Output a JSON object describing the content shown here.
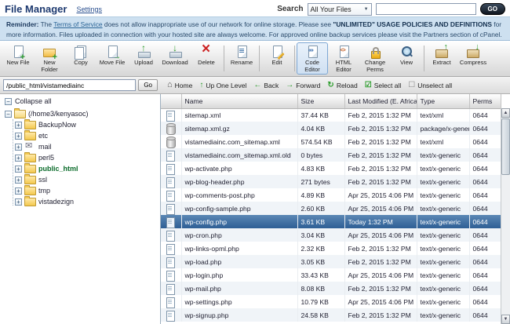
{
  "header": {
    "title": "File Manager",
    "settings": "Settings",
    "search_label": "Search",
    "search_scope": "All Your Files",
    "search_value": "",
    "go": "GO"
  },
  "notice": {
    "reminder": "Reminder:",
    "pre_link": " The ",
    "tos": "Terms of Service",
    "mid": " does not allow inappropriate use of our network for online storage. Please see ",
    "policy": "\"UNLIMITED\" USAGE POLICIES AND DEFINITIONS",
    "tail": " for more information. Files uploaded in connection with your hosted site are always welcome. For approved online backup services please visit the Partners section of cPanel."
  },
  "toolbar": {
    "items": [
      {
        "id": "new-file",
        "label": "New File",
        "icon": "newfile"
      },
      {
        "id": "new-folder",
        "label": "New Folder",
        "icon": "newfolder"
      },
      {
        "id": "copy",
        "label": "Copy",
        "icon": "copy"
      },
      {
        "id": "move-file",
        "label": "Move File",
        "icon": "move"
      },
      {
        "id": "upload",
        "label": "Upload",
        "icon": "upload"
      },
      {
        "id": "download",
        "label": "Download",
        "icon": "download"
      },
      {
        "id": "delete",
        "label": "Delete",
        "icon": "delete",
        "sep_after": true
      },
      {
        "id": "rename",
        "label": "Rename",
        "icon": "rename",
        "sep_after": true
      },
      {
        "id": "edit",
        "label": "Edit",
        "icon": "edit",
        "sep_after": true
      },
      {
        "id": "code-editor",
        "label": "Code Editor",
        "icon": "code",
        "selected": true
      },
      {
        "id": "html-editor",
        "label": "HTML Editor",
        "icon": "html"
      },
      {
        "id": "change-perms",
        "label": "Change Perms",
        "icon": "perms"
      },
      {
        "id": "view",
        "label": "View",
        "icon": "view",
        "sep_after": true
      },
      {
        "id": "extract",
        "label": "Extract",
        "icon": "extract"
      },
      {
        "id": "compress",
        "label": "Compress",
        "icon": "compress"
      }
    ]
  },
  "pathbar": {
    "path": "/public_html/vistamediainc",
    "go": "Go",
    "nav": [
      {
        "id": "home",
        "label": "Home",
        "icon": "home"
      },
      {
        "id": "up-one-level",
        "label": "Up One Level",
        "icon": "up"
      },
      {
        "id": "back",
        "label": "Back",
        "icon": "back"
      },
      {
        "id": "forward",
        "label": "Forward",
        "icon": "forward"
      },
      {
        "id": "reload",
        "label": "Reload",
        "icon": "reload"
      },
      {
        "id": "select-all",
        "label": "Select all",
        "icon": "select"
      },
      {
        "id": "unselect-all",
        "label": "Unselect all",
        "icon": "unselect"
      }
    ]
  },
  "sidebar": {
    "collapse_all": "Collapse all",
    "tree": [
      {
        "id": "root",
        "label": "(/home3/kenyasoc)",
        "level": 0,
        "expander": "-",
        "icon": "folder-open"
      },
      {
        "id": "backupnow",
        "label": "BackupNow",
        "level": 1,
        "expander": "+",
        "icon": "folder"
      },
      {
        "id": "etc",
        "label": "etc",
        "level": 1,
        "expander": "+",
        "icon": "folder"
      },
      {
        "id": "mail",
        "label": "mail",
        "level": 1,
        "expander": "+",
        "icon": "mail"
      },
      {
        "id": "perl5",
        "label": "perl5",
        "level": 1,
        "expander": "+",
        "icon": "folder"
      },
      {
        "id": "public-html",
        "label": "public_html",
        "level": 1,
        "expander": "+",
        "icon": "folder",
        "selected": true
      },
      {
        "id": "ssl",
        "label": "ssl",
        "level": 1,
        "expander": "+",
        "icon": "folder"
      },
      {
        "id": "tmp",
        "label": "tmp",
        "level": 1,
        "expander": "+",
        "icon": "folder"
      },
      {
        "id": "vistadezign",
        "label": "vistadezign",
        "level": 1,
        "expander": "+",
        "icon": "folder"
      }
    ]
  },
  "table": {
    "columns": [
      "Name",
      "Size",
      "Last Modified (E. Africa S...",
      "Type",
      "Perms"
    ],
    "rows": [
      {
        "name": "sitemap.xml",
        "size": "37.44 KB",
        "modified": "Feb 2, 2015 1:32 PM",
        "type": "text/xml",
        "perms": "0644",
        "icon": "page"
      },
      {
        "name": "sitemap.xml.gz",
        "size": "4.04 KB",
        "modified": "Feb 2, 2015 1:32 PM",
        "type": "package/x-generic",
        "perms": "0644",
        "icon": "archive"
      },
      {
        "name": "vistamediainc.com_sitemap.xml",
        "size": "574.54 KB",
        "modified": "Feb 2, 2015 1:32 PM",
        "type": "text/xml",
        "perms": "0644",
        "icon": "archive"
      },
      {
        "name": "vistamediainc.com_sitemap.xml.old",
        "size": "0 bytes",
        "modified": "Feb 2, 2015 1:32 PM",
        "type": "text/x-generic",
        "perms": "0644",
        "icon": "page"
      },
      {
        "name": "wp-activate.php",
        "size": "4.83 KB",
        "modified": "Feb 2, 2015 1:32 PM",
        "type": "text/x-generic",
        "perms": "0644",
        "icon": "page"
      },
      {
        "name": "wp-blog-header.php",
        "size": "271 bytes",
        "modified": "Feb 2, 2015 1:32 PM",
        "type": "text/x-generic",
        "perms": "0644",
        "icon": "page"
      },
      {
        "name": "wp-comments-post.php",
        "size": "4.89 KB",
        "modified": "Apr 25, 2015 4:06 PM",
        "type": "text/x-generic",
        "perms": "0644",
        "icon": "page"
      },
      {
        "name": "wp-config-sample.php",
        "size": "2.60 KB",
        "modified": "Apr 25, 2015 4:06 PM",
        "type": "text/x-generic",
        "perms": "0644",
        "icon": "page"
      },
      {
        "name": "wp-config.php",
        "size": "3.61 KB",
        "modified": "Today 1:32 PM",
        "type": "text/x-generic",
        "perms": "0644",
        "icon": "page",
        "selected": true
      },
      {
        "name": "wp-cron.php",
        "size": "3.04 KB",
        "modified": "Apr 25, 2015 4:06 PM",
        "type": "text/x-generic",
        "perms": "0644",
        "icon": "page"
      },
      {
        "name": "wp-links-opml.php",
        "size": "2.32 KB",
        "modified": "Feb 2, 2015 1:32 PM",
        "type": "text/x-generic",
        "perms": "0644",
        "icon": "page"
      },
      {
        "name": "wp-load.php",
        "size": "3.05 KB",
        "modified": "Feb 2, 2015 1:32 PM",
        "type": "text/x-generic",
        "perms": "0644",
        "icon": "page"
      },
      {
        "name": "wp-login.php",
        "size": "33.43 KB",
        "modified": "Apr 25, 2015 4:06 PM",
        "type": "text/x-generic",
        "perms": "0644",
        "icon": "page"
      },
      {
        "name": "wp-mail.php",
        "size": "8.08 KB",
        "modified": "Feb 2, 2015 1:32 PM",
        "type": "text/x-generic",
        "perms": "0644",
        "icon": "page"
      },
      {
        "name": "wp-settings.php",
        "size": "10.79 KB",
        "modified": "Apr 25, 2015 4:06 PM",
        "type": "text/x-generic",
        "perms": "0644",
        "icon": "page"
      },
      {
        "name": "wp-signup.php",
        "size": "24.58 KB",
        "modified": "Feb 2, 2015 1:32 PM",
        "type": "text/x-generic",
        "perms": "0644",
        "icon": "page"
      }
    ]
  },
  "colors": {
    "title_blue": "#1e3a70",
    "notice_bg": "#cde0f0",
    "selected_row": "#2e5f95",
    "selected_tree": "#0a6b2a",
    "toolbar_selected_bg": "#dce8f4"
  }
}
